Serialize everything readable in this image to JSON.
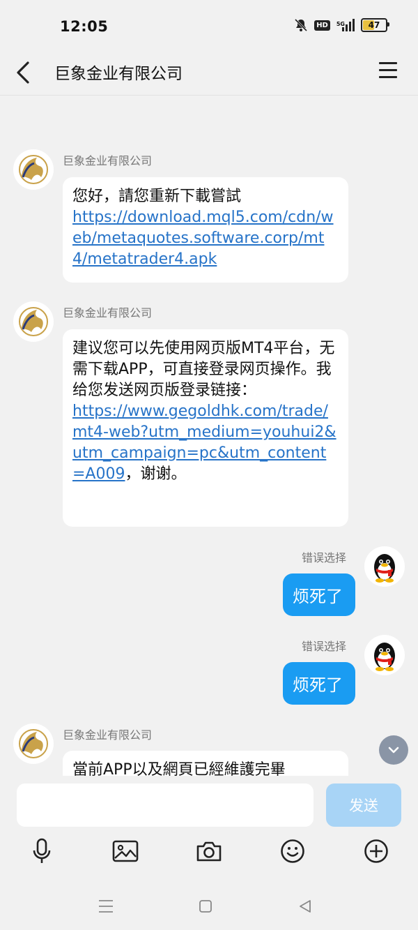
{
  "status_bar": {
    "time": "12:05",
    "hd_label": "HD",
    "network": "5G",
    "battery": "47",
    "battery_level": 0.47
  },
  "header": {
    "title": "巨象金业有限公司"
  },
  "messages": [
    {
      "sender": "巨象金业有限公司",
      "side": "left",
      "text": "您好，請您重新下載嘗試",
      "link": "https://download.mql5.com/cdn/web/metaquotes.software.corp/mt4/metatrader4.apk"
    },
    {
      "sender": "巨象金业有限公司",
      "side": "left",
      "text": "建议您可以先使用网页版MT4平台，无需下载APP，可直接登录网页操作。我给您发送网页版登录链接：",
      "link": "https://www.gegoldhk.com/trade/mt4-web?utm_medium=youhui2&utm_campaign=pc&utm_content=A009",
      "text_after": "，谢谢。"
    },
    {
      "sender": "错误选择",
      "side": "right",
      "text": "烦死了"
    },
    {
      "sender": "错误选择",
      "side": "right",
      "text": "烦死了"
    },
    {
      "sender": "巨象金业有限公司",
      "side": "left",
      "text": "當前APP以及網頁已經維護完畢"
    }
  ],
  "input": {
    "placeholder": "",
    "send_label": "发送"
  },
  "toolbar": {
    "items": [
      "microphone-icon",
      "image-icon",
      "camera-icon",
      "emoji-icon",
      "plus-icon"
    ]
  },
  "colors": {
    "bubble_blue": "#1a9cf2",
    "link": "#2673c8",
    "send_disabled": "#a8d4f6"
  }
}
